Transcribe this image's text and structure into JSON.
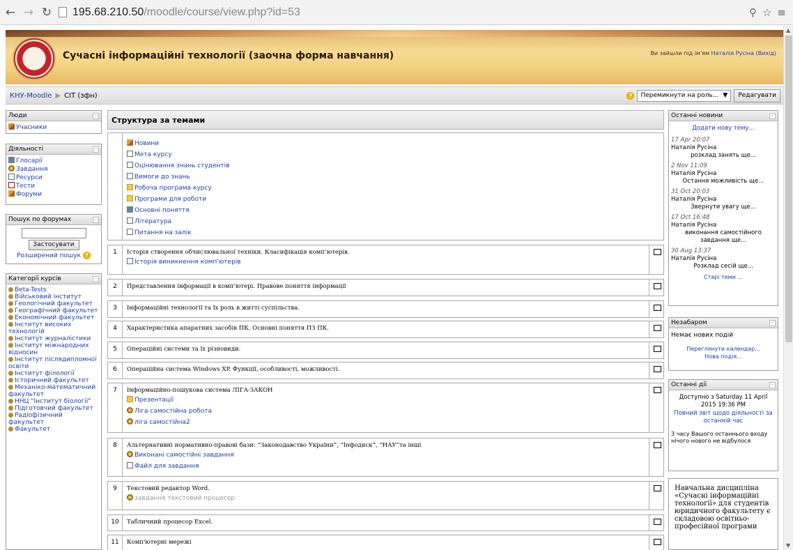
{
  "browser": {
    "url_host": "195.68.210.50",
    "url_path": "/moodle/course/view.php?id=53"
  },
  "header": {
    "site_title": "Сучасні інформаційні технології (заочна форма навчання)",
    "login_prefix": "Ви зайшли під ім'ям",
    "login_user": "Наталія Русіна (Вихід)"
  },
  "navbar": {
    "crumb_root": "КНУ-Moodle",
    "crumb_course": "СІТ (зфн)",
    "role_switch": "Перемикнути на роль...",
    "edit_button": "Редагувати"
  },
  "left": {
    "people": {
      "title": "Люди",
      "items": [
        "Учасники"
      ]
    },
    "activities": {
      "title": "Діяльності",
      "items": [
        "Глосарії",
        "Завдання",
        "Ресурси",
        "Тести",
        "Форуми"
      ]
    },
    "forum_search": {
      "title": "Пошук по форумах",
      "apply": "Застосувати",
      "advanced": "Розширений пошук"
    },
    "categories": {
      "title": "Категорії курсів",
      "items": [
        "Beta-Tests",
        "Військовий інститут",
        "Геологічний факультет",
        "Географічний факультет",
        "Економічний факультет",
        "Інститут високих технологій",
        "Інститут журналістики",
        "Інститут міжнародних відносин",
        "Інститут післядипломної освіти",
        "Інститут філології",
        "Історичний факультет",
        "Механіко-математичний факультет",
        "ННЦ \"Інститут біології\"",
        "Підготовчий факультет",
        "Радіофізичний факультет",
        "Факультет"
      ]
    }
  },
  "center": {
    "heading": "Структура за темами",
    "topic0_items": [
      "Новини",
      "Мета курсу",
      "Оцінювання знань студентів",
      "Вимоги до знань",
      "Робоча програма курсу",
      "Програми для роботи",
      "Основні поняття",
      "Література",
      "Питання на залік"
    ],
    "sections": [
      {
        "num": "1",
        "title": "Історія створення обчислювальної техніки. Класифікація комп’ютерів.",
        "items": [
          "Історія виникнення комп'ютерів"
        ]
      },
      {
        "num": "2",
        "title": "Представлення інформації в комп’ютері. Правове поняття інформації",
        "items": []
      },
      {
        "num": "3",
        "title": "Інформаційні технології та їх роль в житті суспільства.",
        "items": []
      },
      {
        "num": "4",
        "title": "Характеристика апаратних засобів ПК. Основні поняття ПЗ ПК.",
        "items": []
      },
      {
        "num": "5",
        "title": "Операційні системи та їх різновиди.",
        "items": []
      },
      {
        "num": "6",
        "title": "Операційна система Windows XP. Функції, особливості, можливості.",
        "items": []
      },
      {
        "num": "7",
        "title": "Інформаційно-пошукова система ЛІГА-ЗАКОН",
        "items": [
          "Презентації",
          "Ліга самостійна робота",
          "ліга самостійна2"
        ]
      },
      {
        "num": "8",
        "title": "Альтернативні нормативно-правові бази: “Законодавство України”, “Інфодиск”, “НАУ”та інші",
        "items": [
          "Виконані самостійні завдання",
          "Файл для завдання"
        ]
      },
      {
        "num": "9",
        "title": "Текстовий редактор Word.",
        "items": [
          "завдання текстовий процесор"
        ]
      },
      {
        "num": "10",
        "title": "Табличний процесор Excel.",
        "items": []
      },
      {
        "num": "11",
        "title": "Комп'ютерні мережі",
        "items": []
      }
    ]
  },
  "right": {
    "news": {
      "title": "Останні новини",
      "add": "Додати нову тему...",
      "posts": [
        {
          "date": "17 Apr 20:07",
          "author": "Наталія Русіна",
          "text": "розклад занять ще..."
        },
        {
          "date": "2 Nov 11:09",
          "author": "Наталія Русіна",
          "text": "Остання можливість ще..."
        },
        {
          "date": "31 Oct 20:03",
          "author": "Наталія Русіна",
          "text": "Звернути увагу ще..."
        },
        {
          "date": "17 Oct 16:48",
          "author": "Наталія Русіна",
          "text": "виконання самостійного завдання ще..."
        },
        {
          "date": "30 Aug 13:37",
          "author": "Наталія Русіна",
          "text": "Розклад сесій ще..."
        }
      ],
      "older": "Старі теми ..."
    },
    "upcoming": {
      "title": "Незабаром",
      "empty": "Немає нових подій",
      "calendar": "Переглянути календар...",
      "new_event": "Нова подія..."
    },
    "recent": {
      "title": "Останні дії",
      "since": "Доступно з Saturday 11 April 2015 19:36 PM",
      "full_report": "Повний звіт щодо діяльності за останній час",
      "nothing": "З часу Вашого останнього входу нічого нового не відбулося"
    },
    "description": "Навчальна дисципліна «Сучасні інформаційні технології» для студентів юридичного факультету є складовою освітньо-професійної програми"
  }
}
